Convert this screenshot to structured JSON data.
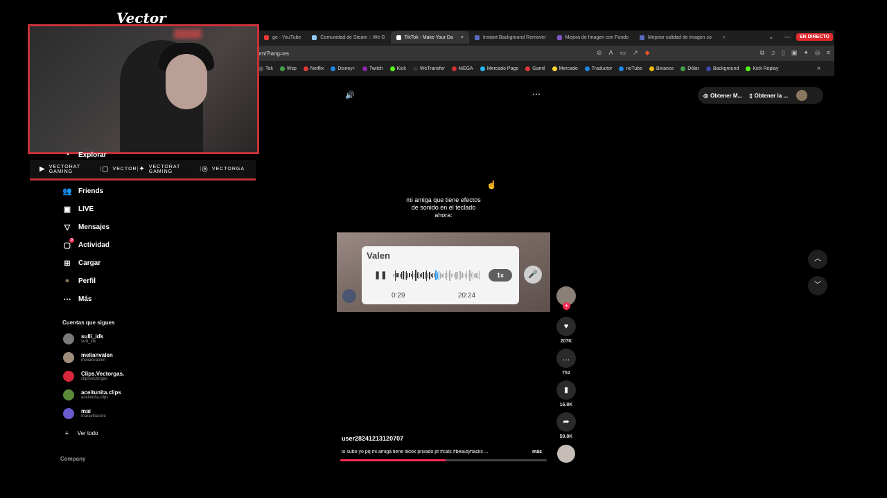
{
  "overlay": {
    "title": "Vector",
    "socials": [
      {
        "icon": "youtube-icon",
        "label": "VECTORAT GAMING"
      },
      {
        "icon": "twitch-icon",
        "label": "VECTOR"
      },
      {
        "icon": "twitter-icon",
        "label": "VECTORAT GAMING"
      },
      {
        "icon": "instagram-icon",
        "label": "VECTORGA"
      }
    ]
  },
  "browser": {
    "tabs": [
      {
        "label": "go - YouTube",
        "color": "#e53935"
      },
      {
        "label": "Comunidad de Steam :: We G",
        "color": "#90caf9"
      },
      {
        "label": "TikTok - Make Your Da",
        "color": "#ffffff",
        "active": true
      },
      {
        "label": "Instant Background Remover",
        "color": "#5c6bc0"
      },
      {
        "label": "Mejora de Imagen con Fondo",
        "color": "#7e57c2"
      },
      {
        "label": "Mejorar calidad de imagen co",
        "color": "#5c6bc0"
      }
    ],
    "new_tab": "+",
    "live_badge": "EN DIRECTO",
    "url": "om/?lang=es",
    "bookmarks": [
      {
        "label": "Tok",
        "color": "#555"
      },
      {
        "label": "Wsp",
        "color": "#43a047"
      },
      {
        "label": "Netflix",
        "color": "#e53935"
      },
      {
        "label": "Disney+",
        "color": "#1e88e5"
      },
      {
        "label": "Twitch",
        "color": "#8e24aa"
      },
      {
        "label": "Kick",
        "color": "#53fc18"
      },
      {
        "label": "WeTransfer",
        "color": "#333"
      },
      {
        "label": "MEGA",
        "color": "#d32f2f"
      },
      {
        "label": "Mercado Pago",
        "color": "#29b6f6"
      },
      {
        "label": "Gamil",
        "color": "#e53935"
      },
      {
        "label": "Mercado",
        "color": "#fdd835"
      },
      {
        "label": "Traductor",
        "color": "#1e88e5"
      },
      {
        "label": "noTube",
        "color": "#1e88e5"
      },
      {
        "label": "Binance",
        "color": "#f0b90b"
      },
      {
        "label": "Dólar",
        "color": "#43a047"
      },
      {
        "label": "Background",
        "color": "#3949ab"
      },
      {
        "label": "Kick Replay",
        "color": "#53fc18"
      }
    ]
  },
  "sidebar": {
    "items": [
      {
        "icon": "compass-icon",
        "label": "Explorar"
      },
      {
        "icon": "friends-icon",
        "label": "Friends"
      },
      {
        "icon": "live-icon",
        "label": "LIVE"
      },
      {
        "icon": "messages-icon",
        "label": "Mensajes"
      },
      {
        "icon": "activity-icon",
        "label": "Actividad",
        "badge": "3"
      },
      {
        "icon": "upload-icon",
        "label": "Cargar"
      },
      {
        "icon": "profile-avatar",
        "label": "Perfil"
      },
      {
        "icon": "more-icon",
        "label": "Más"
      }
    ],
    "following_title": "Cuentas que sigues",
    "following": [
      {
        "name": "sulli_idk",
        "handle": "sulli_idk",
        "color": "#7a7a7a"
      },
      {
        "name": "melianvalen",
        "handle": "melianvalenn",
        "color": "#a08d7a"
      },
      {
        "name": "Clips.Vectorgas.",
        "handle": "clipsvectorgas",
        "color": "#d8283a"
      },
      {
        "name": "aceitunita.clips",
        "handle": "aceitunita.clips",
        "color": "#5b8a3a"
      },
      {
        "name": "mai",
        "handle": "maravillacore",
        "color": "#6a5acd"
      }
    ],
    "see_all": "Ver todo",
    "company": "Company"
  },
  "video": {
    "top_actions": [
      "Obtener M...",
      "Obtener la ..."
    ],
    "caption": "mi amiga que tiene efectos de sonido en el teclado ahora:",
    "voice_message": {
      "name": "Valen",
      "speed": "1x",
      "current_time": "0:29",
      "total_time": "20:24",
      "played_fraction": 0.5
    },
    "stats": {
      "likes": "207K",
      "comments": "752",
      "saves": "16.8K",
      "shares": "59.8K"
    },
    "username": "user28241213120707",
    "description": "lo subo yo pq mi amiga tiene tiktok privado pf #cats #beautyhacks ...",
    "more_label": "más",
    "progress": 0.51
  },
  "icons": {
    "volume": "🔊",
    "more": "⋯",
    "cursor": "☝",
    "pause": "❚❚",
    "mic": "🎤"
  }
}
